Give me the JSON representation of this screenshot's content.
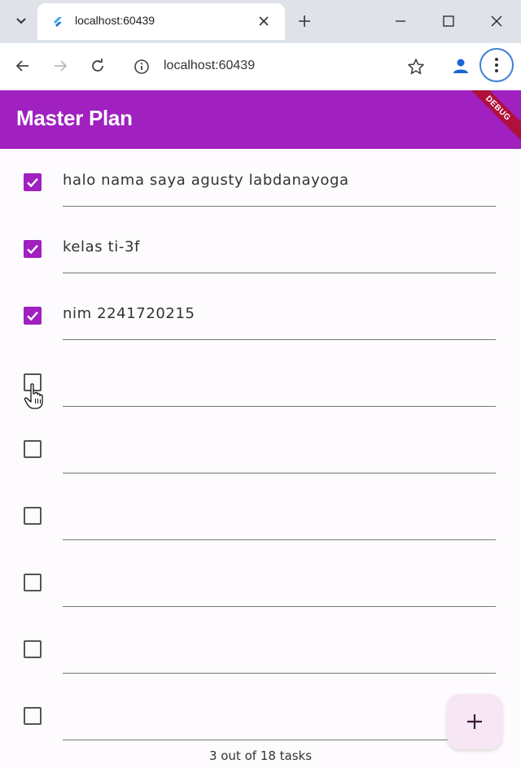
{
  "browser": {
    "tab_title": "localhost:60439",
    "url": "localhost:60439"
  },
  "app": {
    "title": "Master Plan",
    "debug_banner": "DEBUG",
    "accent_color": "#a020c0"
  },
  "tasks": [
    {
      "text": "halo nama saya agusty labdanayoga",
      "done": true
    },
    {
      "text": "kelas ti-3f",
      "done": true
    },
    {
      "text": "nim 2241720215",
      "done": true
    },
    {
      "text": "",
      "done": false
    },
    {
      "text": "",
      "done": false
    },
    {
      "text": "",
      "done": false
    },
    {
      "text": "",
      "done": false
    },
    {
      "text": "",
      "done": false
    },
    {
      "text": "",
      "done": false
    }
  ],
  "footer": {
    "progress_text": "3 out of 18 tasks"
  },
  "fab": {
    "icon": "plus-icon"
  }
}
